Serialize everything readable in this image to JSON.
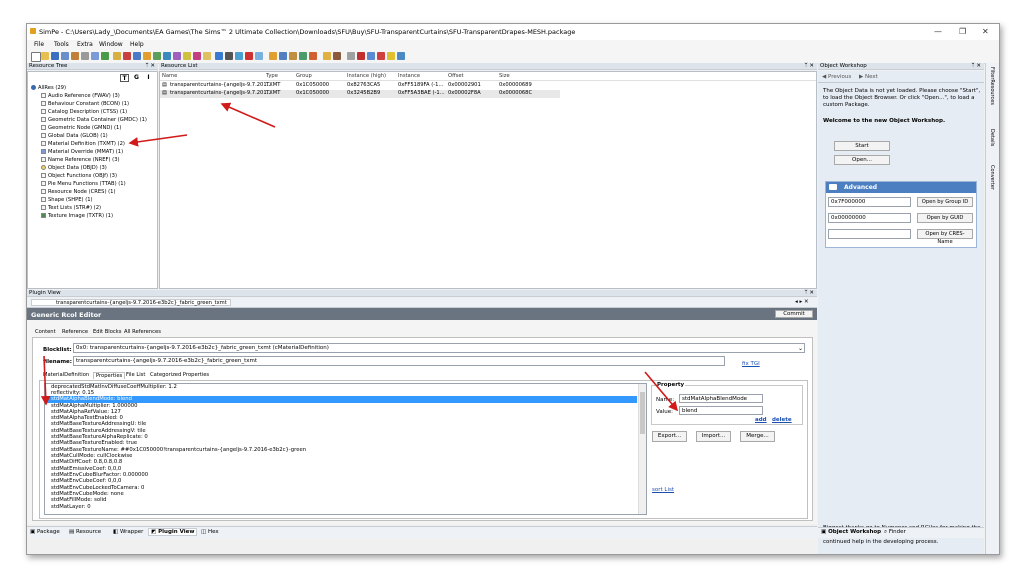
{
  "window": {
    "title": "SimPe - C:\\Users\\Lady_\\Documents\\EA Games\\The Sims™ 2 Ultimate Collection\\Downloads\\SFU\\Buy\\SFU-TransparentCurtains\\SFU-TransparentDrapes-MESH.package",
    "controls": [
      "—",
      "❐",
      "✕"
    ]
  },
  "menu": [
    "File",
    "Tools",
    "Extra",
    "Window",
    "Help"
  ],
  "resource_tree": {
    "header": "Resource Tree",
    "filter_buttons": [
      "T",
      "G",
      "I"
    ],
    "root": "AllRes (29)",
    "items": [
      "Audio Reference (FWAV) (3)",
      "Behaviour Constant (BCON) (1)",
      "Catalog Description (CTSS) (1)",
      "Geometric Data Container (GMDC) (1)",
      "Geometric Node (GMND) (1)",
      "Global Data (GLOB) (1)",
      "Material Definition (TXMT) (2)",
      "Material Override (MMAT) (1)",
      "Name Reference (NREF) (3)",
      "Object Data (OBJD) (3)",
      "Object Functions (OBJf) (3)",
      "Pie Menu Functions (TTAB) (1)",
      "Resource Node (CRES) (1)",
      "Shape (SHPE) (1)",
      "Text Lists (STR#) (2)",
      "Texture Image (TXTR) (1)"
    ]
  },
  "resource_list": {
    "header": "Resource List",
    "columns": [
      "Name",
      "Type",
      "Group",
      "Instance (high)",
      "Instance",
      "Offset",
      "Size"
    ],
    "rows": [
      [
        "transparentcurtains-{angeljs-9.7.201...",
        "TXMT",
        "0x1C050000",
        "0x82763CA5",
        "0xFF5189FA (-1...",
        "0x00002901",
        "0x00000689"
      ],
      [
        "transparentcurtains-{angeljs-9.7.201...",
        "TXMT",
        "0x1C050000",
        "0x3245B2B9",
        "0xFF5A3BAE (-1...",
        "0x00002F8A",
        "0x0000068C"
      ]
    ]
  },
  "object_workshop": {
    "header": "Object Workshop",
    "nav_prev": "Previous",
    "nav_next": "Next",
    "info": "The Object Data is not yet loaded. Please choose \"Start\", to load the Object Browser. Or click \"Open...\", to load a custom Package.",
    "welcome": "Welcome to the new Object Workshop.",
    "start_btn": "Start",
    "open_btn": "Open...",
    "advanced_title": "Advanced",
    "group_value": "0x7F000000",
    "guid_value": "0x00000000",
    "open_group_btn": "Open by Group ID",
    "open_guid_btn": "Open by GUID",
    "open_cres_btn": "Open by CRES-Name",
    "thanks": "Biggest thanks go to Numenor and RGiles for making the Object Workshop possible in the first place, and their continued help in the developing process.",
    "bottom_tabs": [
      "Object Workshop",
      "Finder"
    ],
    "side_tabs": [
      "FilterResources",
      "Details",
      "Converter"
    ]
  },
  "plugin_view": {
    "header": "Plugin View",
    "doc_tab": "transparentcurtains-{angeljs-9.7.2016-e3b2c}_fabric_green_txmt",
    "editor_title": "Generic Rcol Editor",
    "commit_btn": "Commit",
    "tabs": [
      "Content",
      "Reference",
      "Edit Blocks",
      "All References"
    ],
    "blocklist_label": "Blocklist:",
    "blocklist_value": "0x0: transparentcurtains-{angeljs-9.7.2016-e3b2c}_fabric_green_txmt (cMaterialDefinition)",
    "filename_label": "filename:",
    "filename_value": "transparentcurtains-{angeljs-9.7.2016-e3b2c}_fabric_green_txmt",
    "fix_tgi": "fix TGI",
    "inner_tabs": [
      "MaterialDefinition",
      "Properties",
      "File List",
      "Categorized Properties"
    ],
    "properties": [
      "deprecatedStdMatInvDiffuseCoeffMultiplier: 1.2",
      "reflectivity: 0.15",
      "stdMatAlphaBlendMode: blend",
      "stdMatAlphaMultiplier: 1.000000",
      "stdMatAlphaRefValue: 127",
      "stdMatAlphaTestEnabled: 0",
      "stdMatBaseTextureAddressingU: tile",
      "stdMatBaseTextureAddressingV: tile",
      "stdMatBaseTextureAlphaReplicate: 0",
      "stdMatBaseTextureEnabled: true",
      "stdMatBaseTextureName: ##0x1C050000!transparentcurtains-{angeljs-9.7.2016-e3b2c}-green",
      "stdMatCullMode: cullClockwise",
      "stdMatDiffCoef: 0.8,0.8,0.8",
      "stdMatEmissiveCoef: 0,0,0",
      "stdMatEnvCubeBlurFactor: 0.000000",
      "stdMatEnvCubeCoef: 0,0,0",
      "stdMatEnvCubeLockedToCamera: 0",
      "stdMatEnvCubeMode: none",
      "stdMatFillMode: solid",
      "stdMatLayer: 0"
    ],
    "property_group": "Property",
    "name_label": "Name:",
    "name_value": "stdMatAlphaBlendMode",
    "value_label": "Value:",
    "value_value": "blend",
    "add": "add",
    "delete": "delete",
    "export_btn": "Export...",
    "import_btn": "Import...",
    "merge_btn": "Merge...",
    "sort_list": "sort List"
  },
  "bottom_tabs": [
    "Package",
    "Resource",
    "Wrapper",
    "Plugin View",
    "Hex"
  ],
  "colors": {
    "selection": "#3399ff",
    "editor_title_bg": "#6a7481",
    "annotation_arrow": "#d11a1a",
    "advanced_header": "#4b7fc2"
  }
}
